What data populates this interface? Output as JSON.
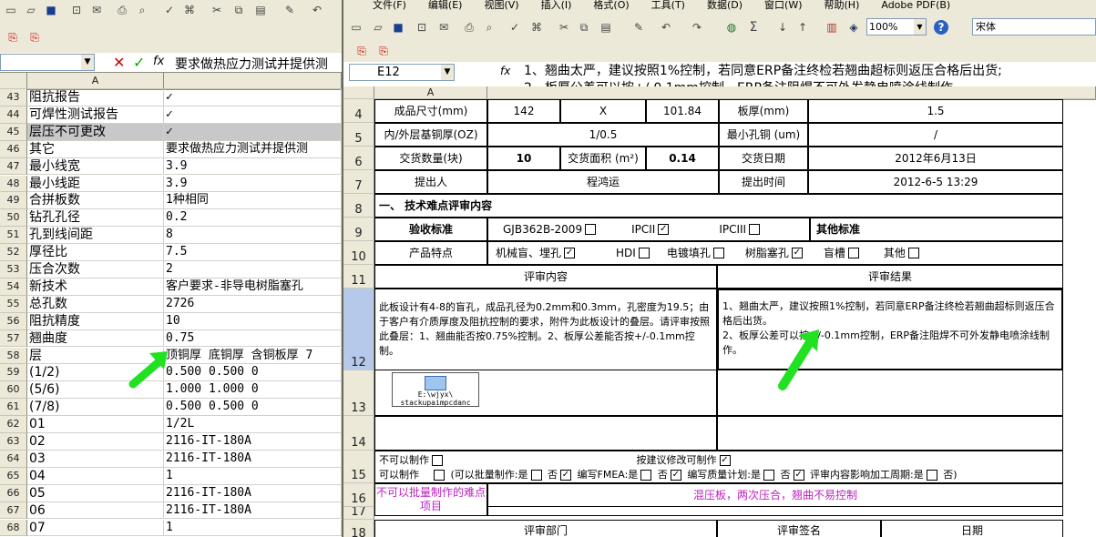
{
  "left": {
    "formula": {
      "text": "要求做热应力测试并提供测"
    },
    "col_header": "A",
    "rows": [
      {
        "n": "43",
        "a": "阻抗报告",
        "b": "✓"
      },
      {
        "n": "44",
        "a": "可焊性测试报告",
        "b": "✓"
      },
      {
        "n": "45",
        "a": "层压不可更改",
        "b": "✓"
      },
      {
        "n": "46",
        "a": "其它",
        "b": "要求做热应力测试并提供测"
      },
      {
        "n": "47",
        "a": "最小线宽",
        "b": "3.9"
      },
      {
        "n": "48",
        "a": "最小线距",
        "b": "3.9"
      },
      {
        "n": "49",
        "a": "合拼板数",
        "b": "1种相同"
      },
      {
        "n": "50",
        "a": "钻孔孔径",
        "b": "0.2"
      },
      {
        "n": "51",
        "a": "孔到线间距",
        "b": "8"
      },
      {
        "n": "52",
        "a": "厚径比",
        "b": "7.5"
      },
      {
        "n": "53",
        "a": "压合次数",
        "b": "2"
      },
      {
        "n": "54",
        "a": "新技术",
        "b": "客户要求-非导电树脂塞孔"
      },
      {
        "n": "55",
        "a": "总孔数",
        "b": "2726"
      },
      {
        "n": "56",
        "a": "阻抗精度",
        "b": "10"
      },
      {
        "n": "57",
        "a": "翘曲度",
        "b": "0.75"
      },
      {
        "n": "58",
        "a": "层",
        "b": "顶铜厚 底铜厚 含铜板厚 7"
      },
      {
        "n": "59",
        "a": "(1/2)",
        "b": "0.500  0.500     0"
      },
      {
        "n": "60",
        "a": "(5/6)",
        "b": "1.000  1.000     0"
      },
      {
        "n": "61",
        "a": "(7/8)",
        "b": "0.500  0.500     0"
      },
      {
        "n": "62",
        "a": "01",
        "b": "1/2L"
      },
      {
        "n": "63",
        "a": "02",
        "b": "2116-IT-180A"
      },
      {
        "n": "64",
        "a": "03",
        "b": "2116-IT-180A"
      },
      {
        "n": "65",
        "a": "04",
        "b": "1"
      },
      {
        "n": "66",
        "a": "05",
        "b": "2116-IT-180A"
      },
      {
        "n": "67",
        "a": "06",
        "b": "2116-IT-180A"
      },
      {
        "n": "68",
        "a": "07",
        "b": "1"
      }
    ]
  },
  "right": {
    "menu": [
      "文件(F)",
      "编辑(E)",
      "视图(V)",
      "插入(I)",
      "格式(O)",
      "工具(T)",
      "数据(D)",
      "窗口(W)",
      "帮助(H)",
      "Adobe PDF(B)"
    ],
    "zoom": "100%",
    "font": "宋体",
    "namebox": "E12",
    "formula_line1": "1、翘曲太严，建议按照1%控制，若同意ERP备注终检若翘曲超标则返压合格后出货;",
    "formula_line2": "2、板厚公差可以按+/-0.1mm控制，ERP备注阻焊不可外发静电喷涂线制作。",
    "col_a": "A",
    "row_nums": [
      "4",
      "5",
      "6",
      "7",
      "8",
      "9",
      "10",
      "11",
      "12",
      "13",
      "14",
      "15",
      "16",
      "17",
      "18"
    ],
    "f": {
      "r4a": "成品尺寸(mm)",
      "r4b": "142",
      "r4c": "X",
      "r4d": "101.84",
      "r4e": "板厚(mm)",
      "r4f": "1.5",
      "r5a": "内/外层基铜厚(OZ)",
      "r5b": "1/0.5",
      "r5e": "最小孔铜 (um)",
      "r5f": "/",
      "r6a": "交货数量(块)",
      "r6b": "10",
      "r6c": "交货面积 (m²)",
      "r6d": "0.14",
      "r6e": "交货日期",
      "r6f": "2012年6月13日",
      "r7a": "提出人",
      "r7b": "程鸿运",
      "r7e": "提出时间",
      "r7f": "2012-6-5  13:29",
      "r8": "一、 技术难点评审内容",
      "r9a": "验收标准",
      "r9b": "GJB362B-2009",
      "r9c": "IPCII",
      "r9d": "IPCIII",
      "r9e": "其他标准",
      "r10a": "产品特点",
      "r10b": "机械盲、埋孔",
      "r10c": "HDI",
      "r10d": "电镀填孔",
      "r10e": "树脂塞孔",
      "r10f": "盲槽",
      "r10g": "其他",
      "r11a": "评审内容",
      "r11b": "评审结果",
      "r12a": "此板设计有4-8的盲孔，成品孔径为0.2mm和0.3mm，孔密度为19.5；由于客户有介质厚度及阻抗控制的要求，附件为此板设计的叠层。请评审按照此叠层：1、翘曲能否按0.75%控制。2、板厚公差能否按+/-0.1mm控制。",
      "r12b": "1、翘曲太严，建议按照1%控制，若同意ERP备注终检若翘曲超标则返压合格后出货。\n2、板厚公差可以按+/-0.1mm控制，ERP备注阻焊不可外发静电喷涂线制作。",
      "r13img": "E:\\wjyx\\ stackupaimpcdanc",
      "r15a": "不可以制作",
      "r15b": "按建议修改可制作",
      "r15c": "可以制作",
      "r15d": "(可以批量制作:是",
      "r15e": "否",
      "r15f": "编写FMEA:是",
      "r15g": "否",
      "r15h": "编写质量计划:是",
      "r15i": "否",
      "r15j": "评审内容影响加工周期:是",
      "r15k": "否)",
      "r16a": "不可以批量制作的难点项目",
      "r16b": "混压板，两次压合，翘曲不易控制",
      "r18a": "评审部门",
      "r18b": "评审签名",
      "r18c": "日期"
    }
  }
}
